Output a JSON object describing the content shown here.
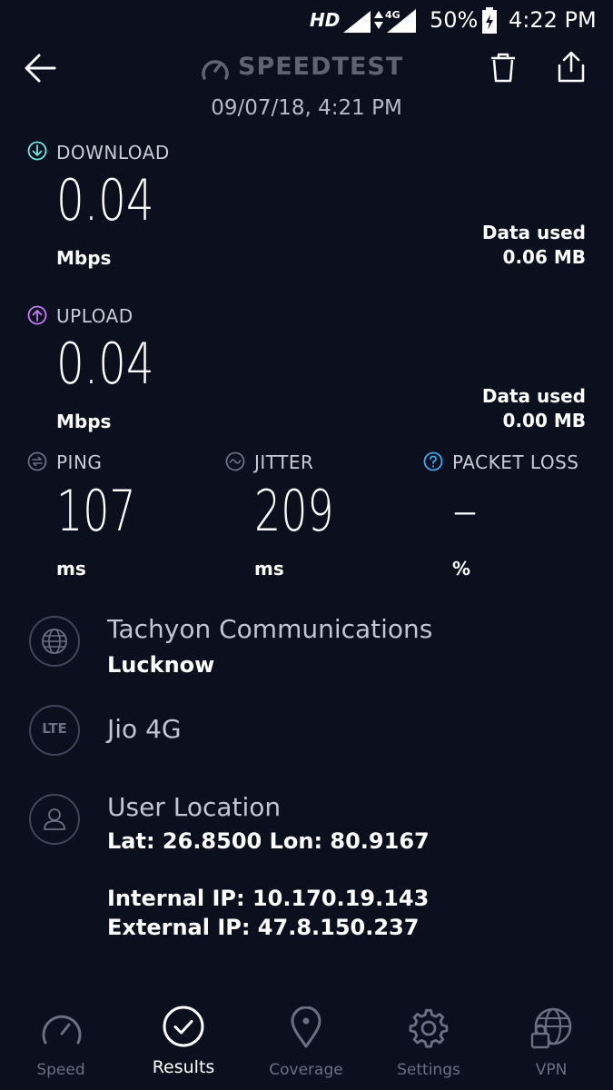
{
  "status_bar": {
    "network_badge": "HD",
    "lte": "4G",
    "battery_percent": "50%",
    "time": "4:22 PM"
  },
  "header": {
    "title": "SPEEDTEST",
    "date": "09/07/18, 4:21 PM",
    "back_icon": "arrow-left-icon",
    "delete_icon": "trash-icon",
    "share_icon": "share-icon"
  },
  "download": {
    "label": "DOWNLOAD",
    "value": "0.04",
    "unit": "Mbps",
    "data_used_label": "Data used",
    "data_used_value": "0.06 MB",
    "color": "#6ee6e0"
  },
  "upload": {
    "label": "UPLOAD",
    "value": "0.04",
    "unit": "Mbps",
    "data_used_label": "Data used",
    "data_used_value": "0.00 MB",
    "color": "#c57ef0"
  },
  "ping": {
    "label": "PING",
    "value": "107",
    "unit": "ms"
  },
  "jitter": {
    "label": "JITTER",
    "value": "209",
    "unit": "ms"
  },
  "packet_loss": {
    "label": "PACKET LOSS",
    "value": "–",
    "unit": "%",
    "color": "#3fa9ee"
  },
  "provider": {
    "name": "Tachyon Communications",
    "city": "Lucknow",
    "icon": "globe-icon"
  },
  "network": {
    "icon_text": "LTE",
    "name": "Jio 4G"
  },
  "location": {
    "title": "User Location",
    "coords": "Lat: 26.8500 Lon: 80.9167",
    "internal_ip": "Internal IP: 10.170.19.143",
    "external_ip": "External IP: 47.8.150.237",
    "icon": "user-icon"
  },
  "nav": {
    "items": [
      {
        "label": "Speed",
        "icon": "speedometer-icon"
      },
      {
        "label": "Results",
        "icon": "check-circle-icon"
      },
      {
        "label": "Coverage",
        "icon": "map-pin-icon"
      },
      {
        "label": "Settings",
        "icon": "gear-icon"
      },
      {
        "label": "VPN",
        "icon": "vpn-globe-lock-icon"
      }
    ],
    "active": "Results"
  }
}
